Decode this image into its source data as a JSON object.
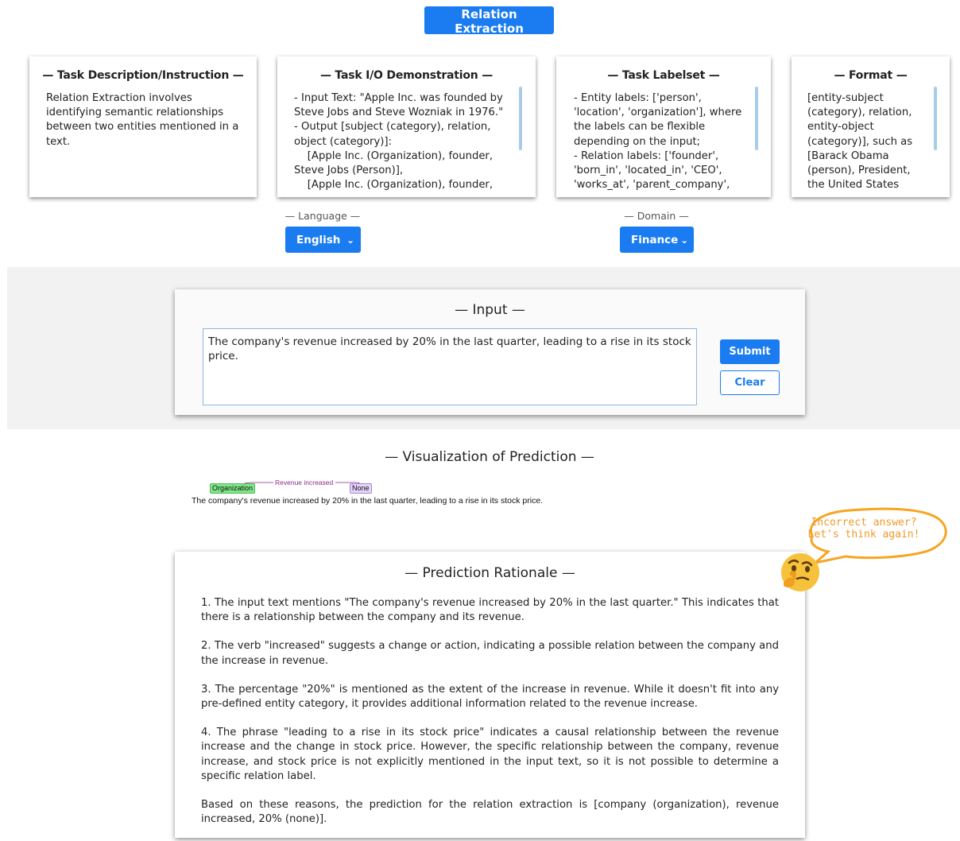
{
  "header": {
    "title": "Relation Extraction"
  },
  "cards": {
    "task_description": {
      "title": "— Task Description/Instruction —",
      "body": "Relation Extraction involves identifying semantic relationships between two entities mentioned in a text."
    },
    "task_io": {
      "title": "— Task I/O Demonstration —",
      "body": "- Input Text: \"Apple Inc. was founded by Steve Jobs and Steve Wozniak in 1976.\"\n- Output [subject (category), relation, object (category)]:\n    [Apple Inc. (Organization), founder, Steve Jobs (Person)],\n    [Apple Inc. (Organization), founder, Steve Wozniak (Person)]"
    },
    "task_labelset": {
      "title": "— Task Labelset —",
      "body": "- Entity labels: ['person', 'location', 'organization'], where the labels can be flexible depending on the input;\n- Relation labels: ['founder', 'born_in', 'located_in', 'CEO', 'works_at', 'parent_company', 'founded_year', 'headquarters_in',"
    },
    "format": {
      "title": "— Format —",
      "body": "[entity-subject (category), relation, entity-object (category)], such as [Barack Obama (person), President, the United States (GPE)], [Barack Obama (person),"
    }
  },
  "selectors": {
    "language": {
      "label": "— Language —",
      "value": "English"
    },
    "domain": {
      "label": "— Domain —",
      "value": "Finance"
    }
  },
  "input": {
    "title": "— Input —",
    "text": "The company's revenue increased by 20% in the last quarter, leading to a rise in its stock price.",
    "submit_label": "Submit",
    "clear_label": "Clear"
  },
  "visualization": {
    "title": "— Visualization of Prediction —",
    "subject_tag": "Organization",
    "object_tag": "None",
    "relation_label": "Revenue increased",
    "sentence": "The   company's revenue increased by  20%  in the last quarter, leading to a rise in its stock price."
  },
  "feedback": {
    "bubble_line1": "Incorrect answer?",
    "bubble_line2": "Let's think again!",
    "bubble_color": "#f5a623",
    "icon": "thinking-face-icon"
  },
  "rationale": {
    "title": "— Prediction Rationale —",
    "paragraphs": [
      "1. The input text mentions \"The company's revenue increased by 20% in the last quarter.\" This indicates that there is a relationship between the company and its revenue.",
      "2. The verb \"increased\" suggests a change or action, indicating a possible relation between the company and the increase in revenue.",
      "3. The percentage \"20%\" is mentioned as the extent of the increase in revenue. While it doesn't fit into any pre-defined entity category, it provides additional information related to the revenue increase.",
      "4. The phrase \"leading to a rise in its stock price\" indicates a causal relationship between the revenue increase and the change in stock price. However, the specific relationship between the company, revenue increase, and stock price is not explicitly mentioned in the input text, so it is not possible to determine a specific relation label.",
      "Based on these reasons, the prediction for the relation extraction is [company (organization), revenue increased, 20% (none)]."
    ]
  },
  "colors": {
    "accent": "#1a7cf0",
    "org_tag": "#7ee787",
    "none_tag": "#e4d3fb",
    "relation": "#8a2a8a"
  }
}
